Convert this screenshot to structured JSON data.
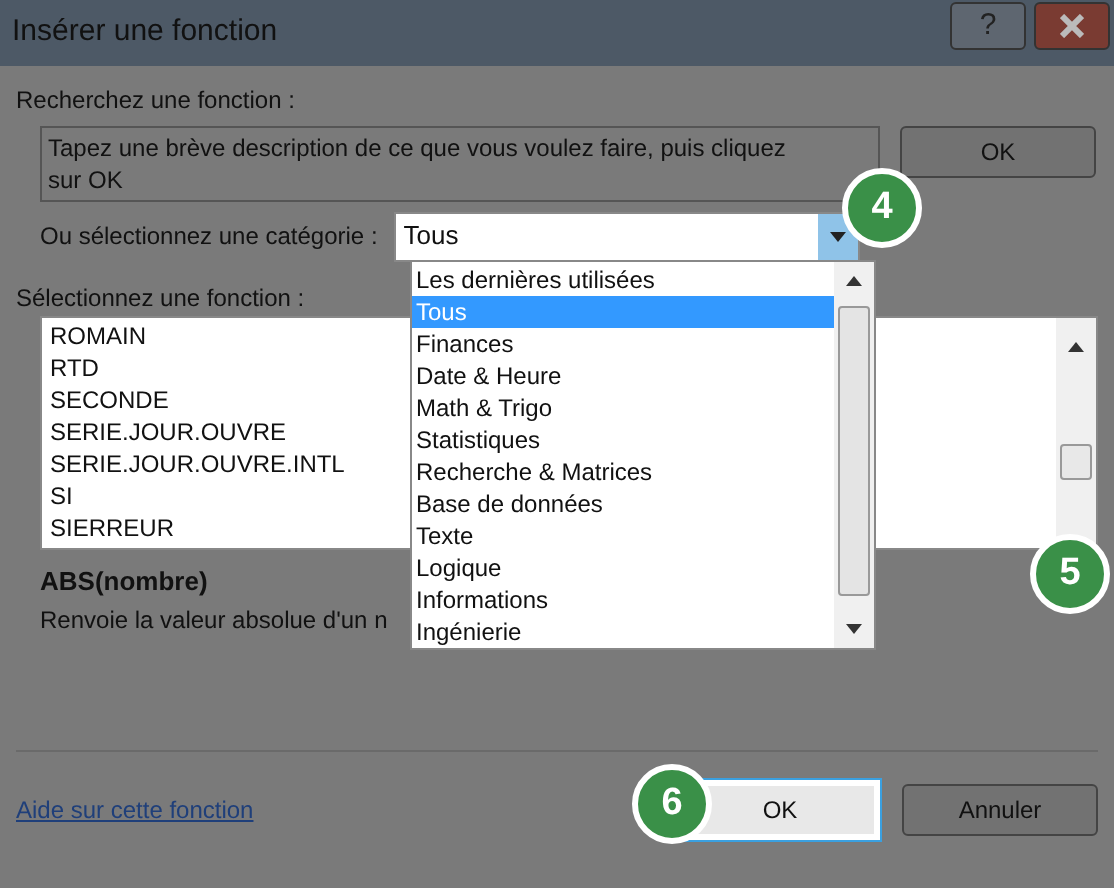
{
  "window": {
    "title": "Insérer une fonction",
    "help_button": "?"
  },
  "search": {
    "label": "Recherchez une fonction :",
    "value": "Tapez une brève description de ce que vous voulez faire, puis cliquez sur OK",
    "button": "OK"
  },
  "category": {
    "label": "Ou sélectionnez une catégorie :",
    "value": "Tous",
    "expanded": true,
    "options": [
      {
        "label": "Les dernières utilisées",
        "selected": false
      },
      {
        "label": "Tous",
        "selected": true
      },
      {
        "label": "Finances",
        "selected": false
      },
      {
        "label": "Date & Heure",
        "selected": false
      },
      {
        "label": "Math & Trigo",
        "selected": false
      },
      {
        "label": "Statistiques",
        "selected": false
      },
      {
        "label": "Recherche & Matrices",
        "selected": false
      },
      {
        "label": "Base de données",
        "selected": false
      },
      {
        "label": "Texte",
        "selected": false
      },
      {
        "label": "Logique",
        "selected": false
      },
      {
        "label": "Informations",
        "selected": false
      },
      {
        "label": "Ingénierie",
        "selected": false
      }
    ]
  },
  "functions": {
    "label": "Sélectionnez une fonction :",
    "items": [
      {
        "label": "ROMAIN",
        "selected": false
      },
      {
        "label": "RTD",
        "selected": false
      },
      {
        "label": "SECONDE",
        "selected": false
      },
      {
        "label": "SERIE.JOUR.OUVRE",
        "selected": false
      },
      {
        "label": "SERIE.JOUR.OUVRE.INTL",
        "selected": false
      },
      {
        "label": "SI",
        "selected": false
      },
      {
        "label": "SIERREUR",
        "selected": false
      }
    ]
  },
  "description": {
    "signature": "ABS(nombre)",
    "text": "Renvoie la valeur absolue d'un n"
  },
  "help_link": "Aide sur cette fonction",
  "buttons": [
    {
      "label": "OK",
      "focused": true
    },
    {
      "label": "Annuler",
      "focused": false
    }
  ],
  "callouts": [
    "4",
    "5",
    "6"
  ]
}
